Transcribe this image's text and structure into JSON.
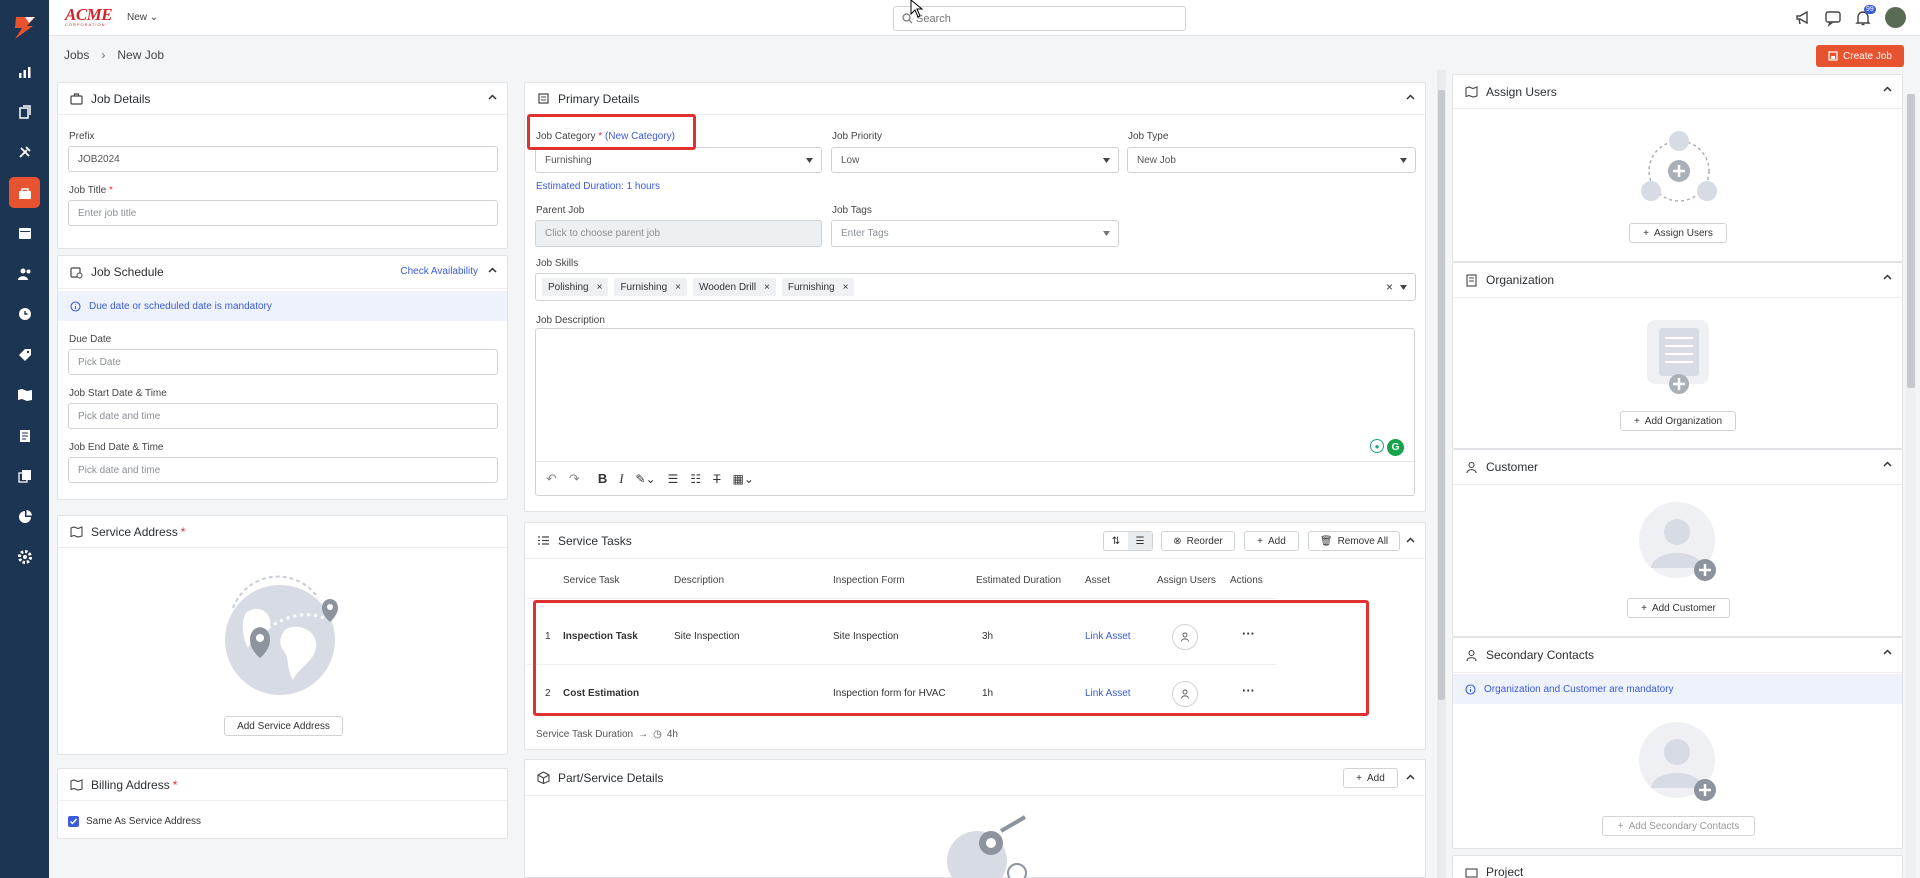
{
  "brand": {
    "name": "ACME",
    "sub": "CORPORATION"
  },
  "topbar": {
    "new_label": "New",
    "search_placeholder": "Search",
    "notification_count": "99"
  },
  "breadcrumb": {
    "parent": "Jobs",
    "current": "New Job"
  },
  "actions": {
    "create_job": "Create Job"
  },
  "job_details": {
    "title": "Job Details",
    "prefix_label": "Prefix",
    "prefix_value": "JOB2024",
    "job_title_label": "Job Title",
    "job_title_placeholder": "Enter job title"
  },
  "job_schedule": {
    "title": "Job Schedule",
    "check_availability": "Check Availability",
    "notice": "Due date or scheduled date is mandatory",
    "due_date_label": "Due Date",
    "due_date_placeholder": "Pick Date",
    "start_label": "Job Start Date & Time",
    "start_placeholder": "Pick date and time",
    "end_label": "Job End Date & Time",
    "end_placeholder": "Pick date and time"
  },
  "service_address": {
    "title": "Service Address",
    "add_button": "Add Service Address"
  },
  "billing_address": {
    "title": "Billing Address",
    "same_as_service": "Same As Service Address"
  },
  "primary_details": {
    "title": "Primary Details",
    "category_label": "Job Category",
    "new_category": "(New Category)",
    "category_value": "Furnishing",
    "estimated_duration": "Estimated Duration: 1 hours",
    "priority_label": "Job Priority",
    "priority_value": "Low",
    "type_label": "Job Type",
    "type_value": "New Job",
    "parent_label": "Parent Job",
    "parent_placeholder": "Click to choose parent job",
    "tags_label": "Job Tags",
    "tags_placeholder": "Enter Tags",
    "skills_label": "Job Skills",
    "skills": [
      "Polishing",
      "Furnishing",
      "Wooden Drill",
      "Furnishing"
    ],
    "description_label": "Job Description"
  },
  "service_tasks": {
    "title": "Service Tasks",
    "reorder": "Reorder",
    "add": "Add",
    "remove_all": "Remove All",
    "columns": [
      "Service Task",
      "Description",
      "Inspection Form",
      "Estimated Duration",
      "Asset",
      "Assign Users",
      "Actions"
    ],
    "rows": [
      {
        "num": "1",
        "task": "Inspection Task",
        "description": "Site Inspection",
        "form": "Site Inspection",
        "duration": "3h",
        "asset": "Link Asset"
      },
      {
        "num": "2",
        "task": "Cost Estimation",
        "description": "",
        "form": "Inspection form for HVAC",
        "duration": "1h",
        "asset": "Link Asset"
      }
    ],
    "duration_label": "Service Task Duration",
    "duration_value": "4h"
  },
  "parts": {
    "title": "Part/Service Details",
    "add": "Add"
  },
  "right": {
    "assign_users": {
      "title": "Assign Users",
      "button": "Assign Users"
    },
    "organization": {
      "title": "Organization",
      "button": "Add Organization"
    },
    "customer": {
      "title": "Customer",
      "button": "Add Customer"
    },
    "secondary": {
      "title": "Secondary Contacts",
      "notice": "Organization and Customer are mandatory",
      "button": "Add Secondary Contacts"
    },
    "project": {
      "title": "Project"
    }
  },
  "colors": {
    "accent": "#e8532f",
    "sidebar": "#1c3552",
    "link": "#3b5bdb",
    "highlight": "#e03131"
  }
}
